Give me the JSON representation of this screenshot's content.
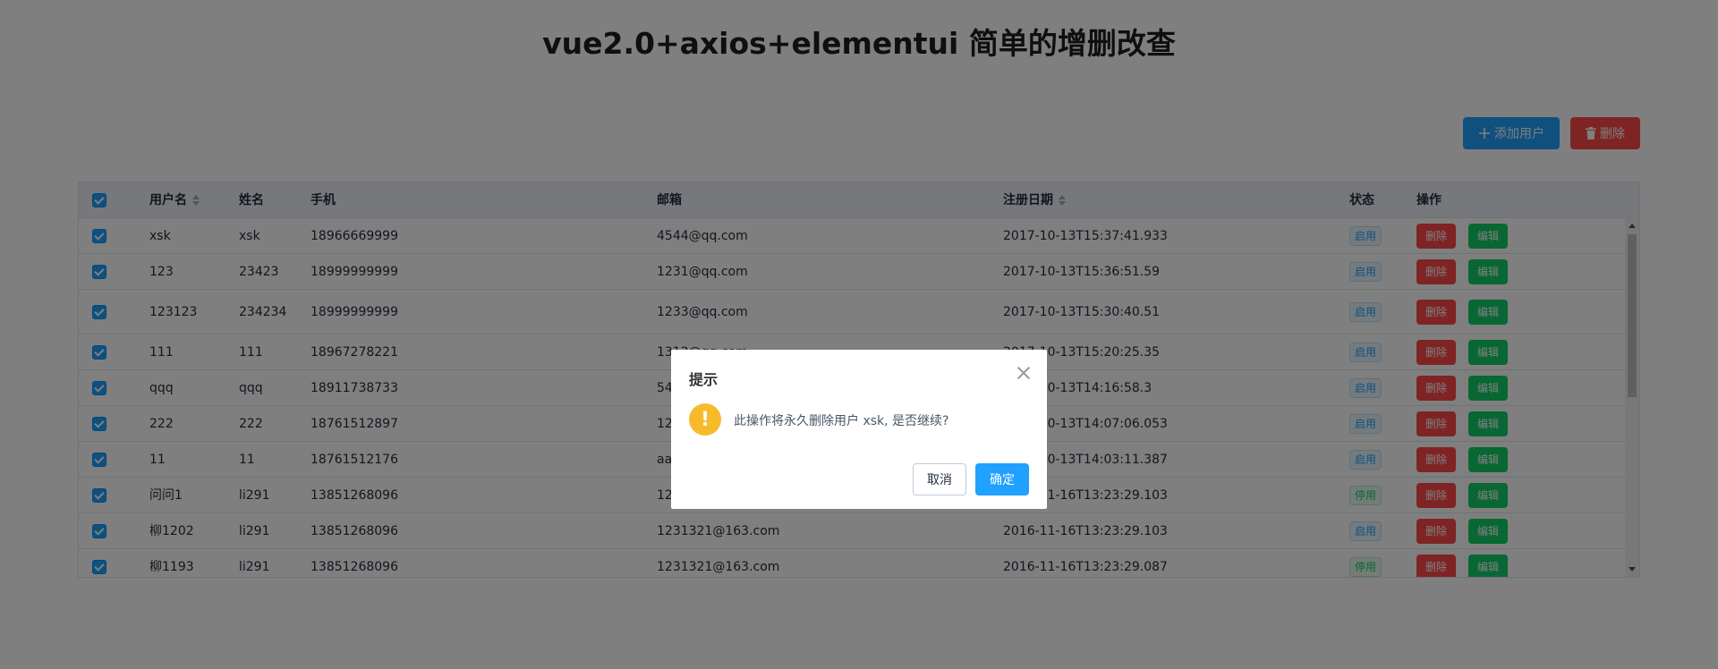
{
  "page": {
    "title": "vue2.0+axios+elementui 简单的增删改查"
  },
  "toolbar": {
    "add_label": "添加用户",
    "delete_label": "删除"
  },
  "table": {
    "headers": {
      "username": "用户名",
      "name": "姓名",
      "phone": "手机",
      "email": "邮箱",
      "regdate": "注册日期",
      "status": "状态",
      "actions": "操作"
    },
    "row_action_delete": "删除",
    "row_action_edit": "编辑",
    "rows": [
      {
        "username": "xsk",
        "name": "xsk",
        "phone": "18966669999",
        "email": "4544@qq.com",
        "regdate": "2017-10-13T15:37:41.933",
        "status": "启用",
        "status_color": "blue",
        "tall": false
      },
      {
        "username": "123",
        "name": "23423",
        "phone": "18999999999",
        "email": "1231@qq.com",
        "regdate": "2017-10-13T15:36:51.59",
        "status": "启用",
        "status_color": "blue",
        "tall": false
      },
      {
        "username": "123123",
        "name": "234234",
        "phone": "18999999999",
        "email": "1233@qq.com",
        "regdate": "2017-10-13T15:30:40.51",
        "status": "启用",
        "status_color": "blue",
        "tall": true
      },
      {
        "username": "111",
        "name": "111",
        "phone": "18967278221",
        "email": "1312@qq.com",
        "regdate": "2017-10-13T15:20:25.35",
        "status": "启用",
        "status_color": "blue",
        "tall": false
      },
      {
        "username": "qqq",
        "name": "qqq",
        "phone": "18911738733",
        "email": "54",
        "regdate": "2017-10-13T14:16:58.3",
        "status": "启用",
        "status_color": "blue",
        "tall": false
      },
      {
        "username": "222",
        "name": "222",
        "phone": "18761512897",
        "email": "12",
        "regdate": "2017-10-13T14:07:06.053",
        "status": "启用",
        "status_color": "blue",
        "tall": false
      },
      {
        "username": "11",
        "name": "11",
        "phone": "18761512176",
        "email": "aa",
        "regdate": "2017-10-13T14:03:11.387",
        "status": "启用",
        "status_color": "blue",
        "tall": false
      },
      {
        "username": "问问1",
        "name": "li291",
        "phone": "13851268096",
        "email": "12",
        "regdate": "2016-11-16T13:23:29.103",
        "status": "停用",
        "status_color": "green",
        "tall": false
      },
      {
        "username": "柳1202",
        "name": "li291",
        "phone": "13851268096",
        "email": "1231321@163.com",
        "regdate": "2016-11-16T13:23:29.103",
        "status": "启用",
        "status_color": "blue",
        "tall": false
      },
      {
        "username": "柳1193",
        "name": "li291",
        "phone": "13851268096",
        "email": "1231321@163.com",
        "regdate": "2016-11-16T13:23:29.087",
        "status": "停用",
        "status_color": "green",
        "tall": false
      }
    ]
  },
  "dialog": {
    "title": "提示",
    "message": "此操作将永久删除用户 xsk, 是否继续?",
    "cancel_label": "取消",
    "ok_label": "确定",
    "icon": "warning-icon",
    "icon_glyph": "!"
  },
  "colors": {
    "primary": "#20a0ff",
    "danger": "#ff4949",
    "success": "#13ce66",
    "warning": "#f7ba2a"
  }
}
